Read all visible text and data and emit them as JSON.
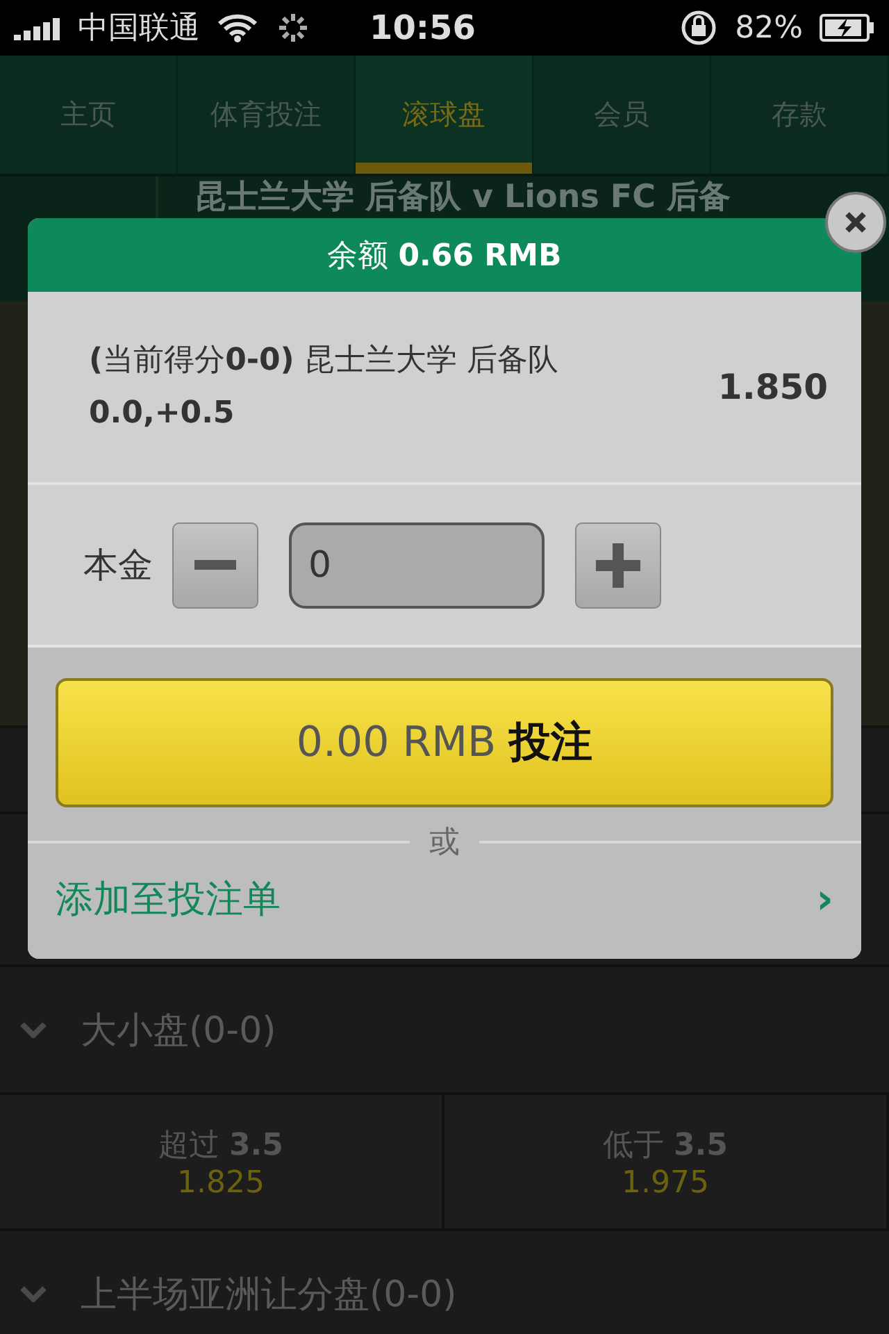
{
  "status_bar": {
    "carrier": "中国联通",
    "time": "10:56",
    "battery": "82%"
  },
  "tabs": [
    {
      "label": "主页",
      "selected": false
    },
    {
      "label": "体育投注",
      "selected": false
    },
    {
      "label": "滚球盘",
      "selected": true
    },
    {
      "label": "会员",
      "selected": false
    },
    {
      "label": "存款",
      "selected": false
    }
  ],
  "match_title": "昆士兰大学 后备队 v Lions FC 后备",
  "markets": [
    {
      "title": "大小盘(0-0)",
      "outcomes": [
        {
          "label": "超过 **3.5**",
          "odds": "1.825"
        },
        {
          "label": "低于 **3.5**",
          "odds": "1.975"
        }
      ]
    },
    {
      "title": "上半场亚洲让分盘(0-0)"
    }
  ],
  "dialog": {
    "balance": "余额 **0.66 RMB**",
    "selection": "**(**当前得分**0-0)** 昆士兰大学 后备队 **0.0,+0.5**",
    "odds": "1.850",
    "stake_label": "本金",
    "stake_value": "0",
    "bet_button": "0.00 RMB **投注**",
    "or": "或",
    "add_link": "添加至投注单",
    "add_chevron": "›"
  }
}
